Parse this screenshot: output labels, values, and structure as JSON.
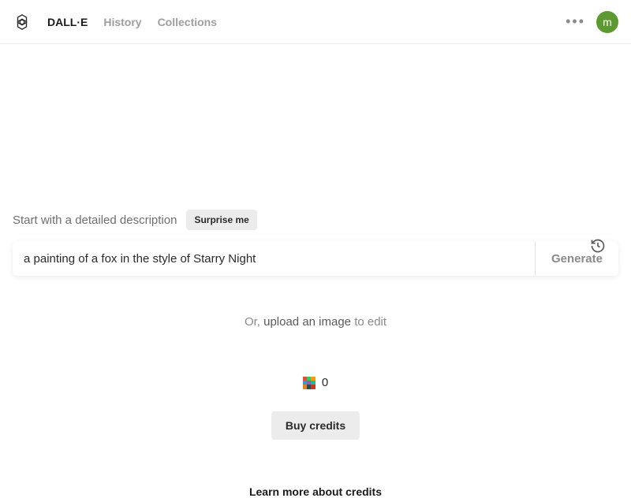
{
  "header": {
    "nav": {
      "dalle": "DALL·E",
      "history": "History",
      "collections": "Collections"
    },
    "avatar_letter": "m"
  },
  "prompt": {
    "label": "Start with a detailed description",
    "surprise_label": "Surprise me",
    "input_value": "a painting of a fox in the style of Starry Night",
    "generate_label": "Generate"
  },
  "upload": {
    "prefix": "Or, ",
    "link": "upload an image",
    "suffix": " to edit"
  },
  "credits": {
    "count": "0",
    "buy_label": "Buy credits",
    "learn_more": "Learn more about credits"
  }
}
